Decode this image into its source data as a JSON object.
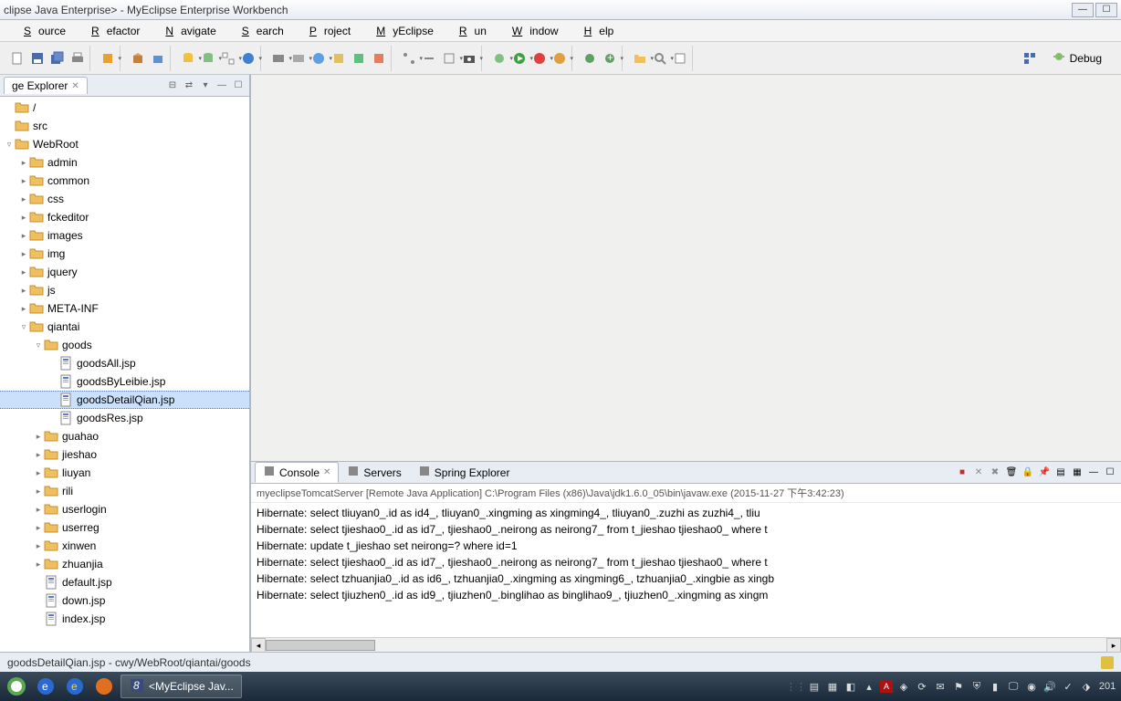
{
  "window": {
    "title_left": "clipse Java Enterprise> - MyEclipse Enterprise Workbench"
  },
  "menubar": [
    "Source",
    "Refactor",
    "Navigate",
    "Search",
    "Project",
    "MyEclipse",
    "Run",
    "Window",
    "Help"
  ],
  "perspective": {
    "debug": "Debug"
  },
  "explorer": {
    "tab": "ge Explorer",
    "tree": [
      {
        "kind": "root",
        "caret": "",
        "label": "/",
        "indent": 0
      },
      {
        "kind": "folder",
        "caret": "",
        "label": "src",
        "indent": 0
      },
      {
        "kind": "folder-open",
        "caret": "▿",
        "label": "WebRoot",
        "indent": 0
      },
      {
        "kind": "folder",
        "caret": "▸",
        "label": "admin",
        "indent": 1
      },
      {
        "kind": "folder",
        "caret": "▸",
        "label": "common",
        "indent": 1
      },
      {
        "kind": "folder",
        "caret": "▸",
        "label": "css",
        "indent": 1
      },
      {
        "kind": "folder",
        "caret": "▸",
        "label": "fckeditor",
        "indent": 1
      },
      {
        "kind": "folder",
        "caret": "▸",
        "label": "images",
        "indent": 1
      },
      {
        "kind": "folder",
        "caret": "▸",
        "label": "img",
        "indent": 1
      },
      {
        "kind": "folder",
        "caret": "▸",
        "label": "jquery",
        "indent": 1
      },
      {
        "kind": "folder",
        "caret": "▸",
        "label": "js",
        "indent": 1
      },
      {
        "kind": "folder",
        "caret": "▸",
        "label": "META-INF",
        "indent": 1
      },
      {
        "kind": "folder-open",
        "caret": "▿",
        "label": "qiantai",
        "indent": 1
      },
      {
        "kind": "folder-open",
        "caret": "▿",
        "label": "goods",
        "indent": 2
      },
      {
        "kind": "jsp",
        "caret": "",
        "label": "goodsAll.jsp",
        "indent": 3
      },
      {
        "kind": "jsp",
        "caret": "",
        "label": "goodsByLeibie.jsp",
        "indent": 3
      },
      {
        "kind": "jsp",
        "caret": "",
        "label": "goodsDetailQian.jsp",
        "indent": 3,
        "selected": true
      },
      {
        "kind": "jsp",
        "caret": "",
        "label": "goodsRes.jsp",
        "indent": 3
      },
      {
        "kind": "folder",
        "caret": "▸",
        "label": "guahao",
        "indent": 2
      },
      {
        "kind": "folder",
        "caret": "▸",
        "label": "jieshao",
        "indent": 2
      },
      {
        "kind": "folder",
        "caret": "▸",
        "label": "liuyan",
        "indent": 2
      },
      {
        "kind": "folder",
        "caret": "▸",
        "label": "rili",
        "indent": 2
      },
      {
        "kind": "folder",
        "caret": "▸",
        "label": "userlogin",
        "indent": 2
      },
      {
        "kind": "folder",
        "caret": "▸",
        "label": "userreg",
        "indent": 2
      },
      {
        "kind": "folder",
        "caret": "▸",
        "label": "xinwen",
        "indent": 2
      },
      {
        "kind": "folder",
        "caret": "▸",
        "label": "zhuanjia",
        "indent": 2
      },
      {
        "kind": "jsp",
        "caret": "",
        "label": "default.jsp",
        "indent": 2
      },
      {
        "kind": "jsp",
        "caret": "",
        "label": "down.jsp",
        "indent": 2
      },
      {
        "kind": "jsp",
        "caret": "",
        "label": "index.jsp",
        "indent": 2
      }
    ]
  },
  "bottom": {
    "tabs": [
      {
        "label": "Console",
        "active": true
      },
      {
        "label": "Servers",
        "active": false
      },
      {
        "label": "Spring Explorer",
        "active": false
      }
    ],
    "console_title": "myeclipseTomcatServer [Remote Java Application] C:\\Program Files (x86)\\Java\\jdk1.6.0_05\\bin\\javaw.exe (2015-11-27 下午3:42:23)",
    "lines": [
      "Hibernate: select tliuyan0_.id as id4_, tliuyan0_.xingming as xingming4_, tliuyan0_.zuzhi as zuzhi4_, tliu",
      "Hibernate: select tjieshao0_.id as id7_, tjieshao0_.neirong as neirong7_ from t_jieshao tjieshao0_ where t",
      "Hibernate: update t_jieshao set neirong=? where id=1",
      "Hibernate: select tjieshao0_.id as id7_, tjieshao0_.neirong as neirong7_ from t_jieshao tjieshao0_ where t",
      "Hibernate: select tzhuanjia0_.id as id6_, tzhuanjia0_.xingming as xingming6_, tzhuanjia0_.xingbie as xingb",
      "Hibernate: select tjiuzhen0_.id as id9_, tjiuzhen0_.binglihao as binglihao9_, tjiuzhen0_.xingming as xingm"
    ]
  },
  "statusbar": {
    "path": "goodsDetailQian.jsp - cwy/WebRoot/qiantai/goods"
  },
  "taskbar": {
    "active_app": "<MyEclipse Jav...",
    "clock": "201"
  }
}
